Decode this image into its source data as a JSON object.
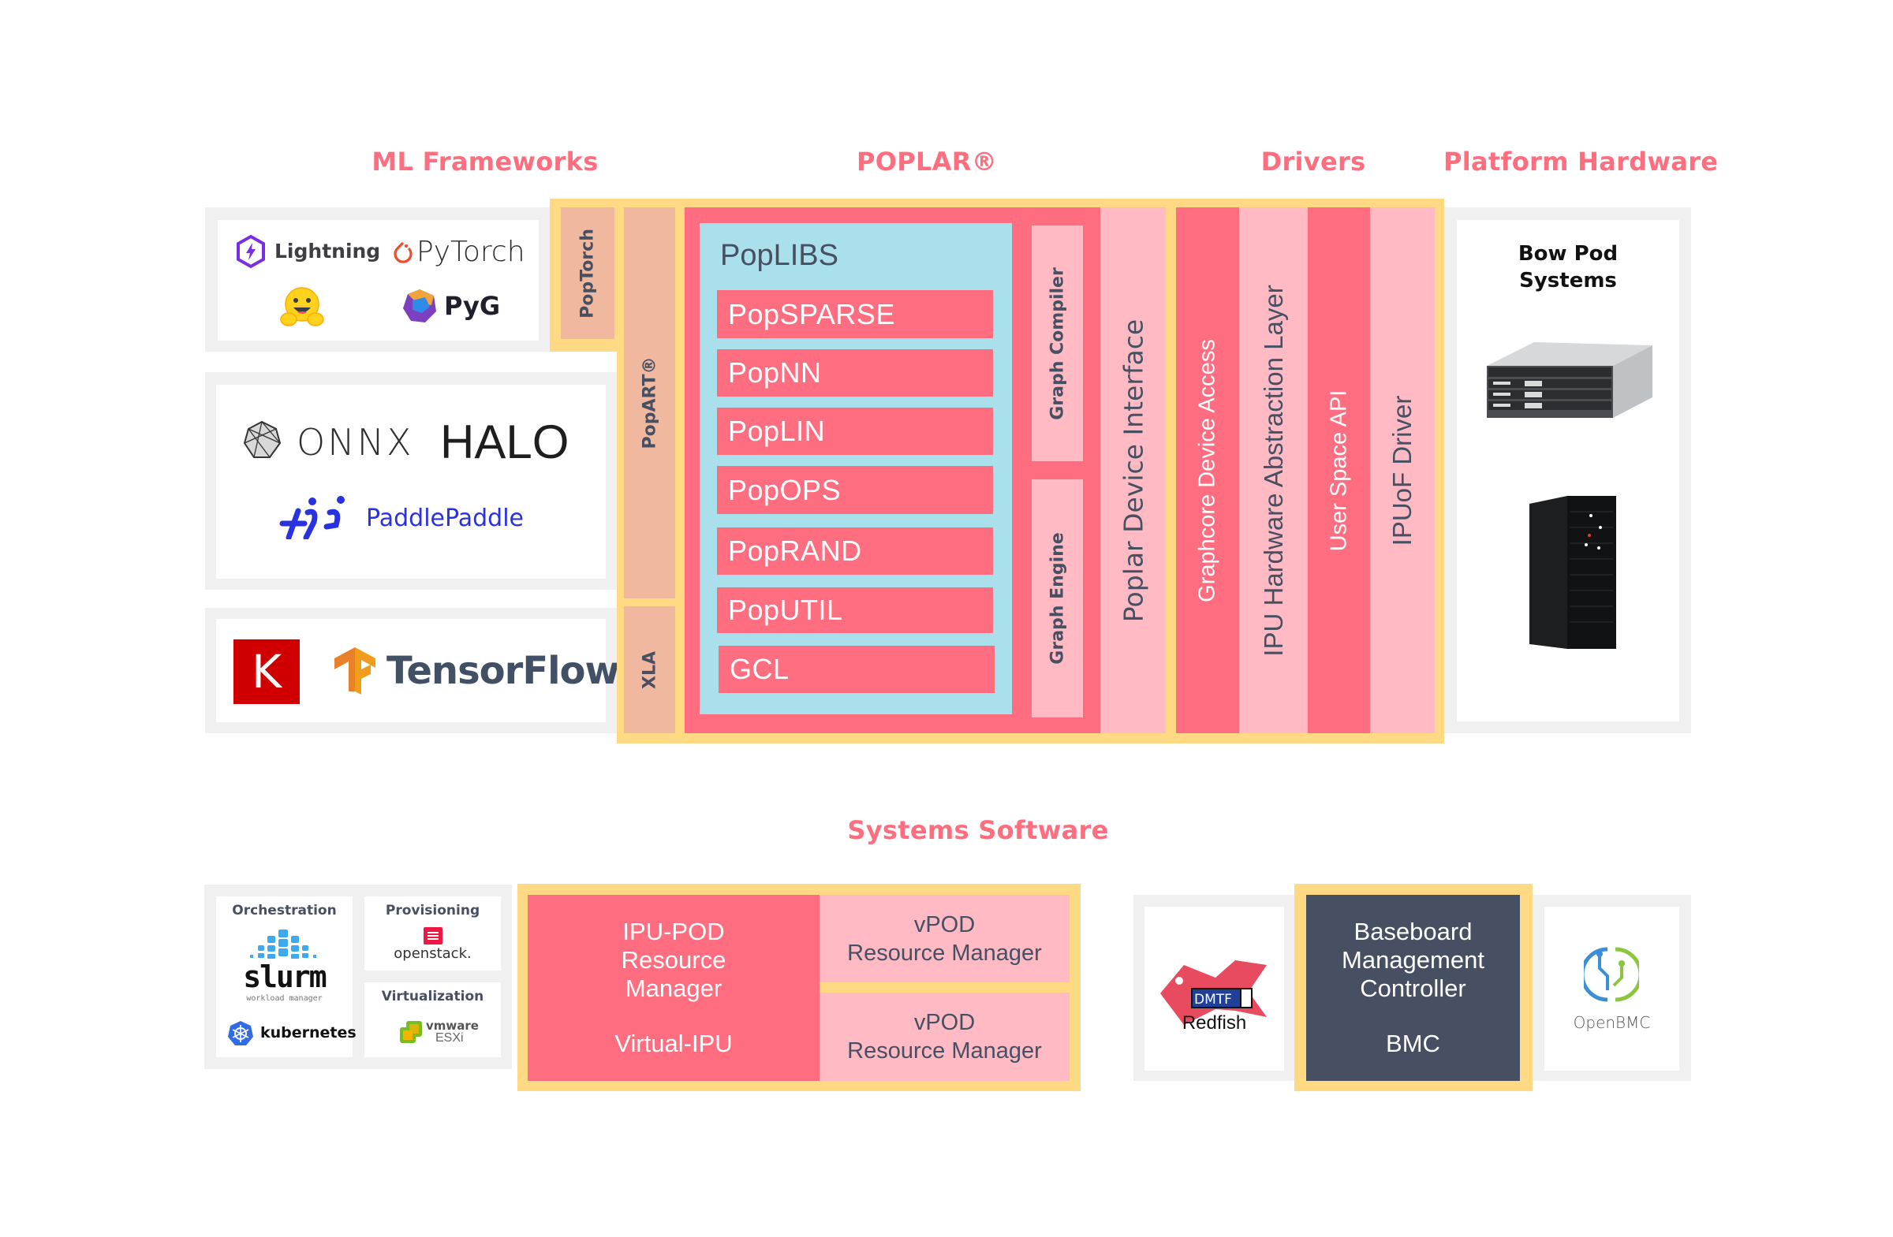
{
  "sections": {
    "ml_frameworks": "ML Frameworks",
    "poplar": "POPLAR®",
    "drivers": "Drivers",
    "platform_hardware": "Platform Hardware",
    "systems_software": "Systems Software"
  },
  "frameworks": {
    "lightning": "Lightning",
    "pytorch": "PyTorch",
    "hugging_face_icon": "hugging-face-emoji",
    "pyg": "PyG",
    "onnx": "ONNX",
    "halo": "HALO",
    "paddlepaddle": "PaddlePaddle",
    "keras": "K",
    "tensorflow": "TensorFlow"
  },
  "poplar": {
    "poptorch": "PopTorch",
    "popart": "PopART®",
    "xla": "XLA",
    "poplibs": "PopLIBS",
    "libraries": [
      "PopSPARSE",
      "PopNN",
      "PopLIN",
      "PopOPS",
      "PopRAND",
      "PopUTIL",
      "GCL"
    ],
    "graph_compiler": "Graph Compiler",
    "graph_engine": "Graph Engine",
    "device_interface": "Poplar Device Interface"
  },
  "drivers": {
    "columns": [
      "Graphcore Device Access",
      "IPU Hardware Abstraction Layer",
      "User Space API",
      "IPUoF Driver"
    ]
  },
  "platform": {
    "title_line1": "Bow Pod",
    "title_line2": "Systems"
  },
  "systems": {
    "orchestration": "Orchestration",
    "slurm": "slurm",
    "slurm_sub": "workload manager",
    "kubernetes": "kubernetes",
    "provisioning": "Provisioning",
    "openstack": "openstack.",
    "virtualization": "Virtualization",
    "vmware": "vmware",
    "esxi": "ESXi",
    "ipu_pod_line1": "IPU-POD",
    "ipu_pod_line2": "Resource",
    "ipu_pod_line3": "Manager",
    "virtual_ipu": "Virtual-IPU",
    "vpod1_line1": "vPOD",
    "vpod1_line2": "Resource Manager",
    "vpod2_line1": "vPOD",
    "vpod2_line2": "Resource Manager",
    "dmtf": "DMTF",
    "redfish": "Redfish",
    "bmc_line1": "Baseboard",
    "bmc_line2": "Management",
    "bmc_line3": "Controller",
    "bmc_short": "BMC",
    "openbmc": "OpenBMC"
  },
  "colors": {
    "accent": "#FF6E7F",
    "yellow": "#FFD984",
    "peach": "#F0B89F",
    "red": "#FF6E80",
    "blue": "#A9E0EC",
    "pink": "#FFBAC4",
    "dark": "#475063",
    "gray": "#F1F0F0"
  }
}
